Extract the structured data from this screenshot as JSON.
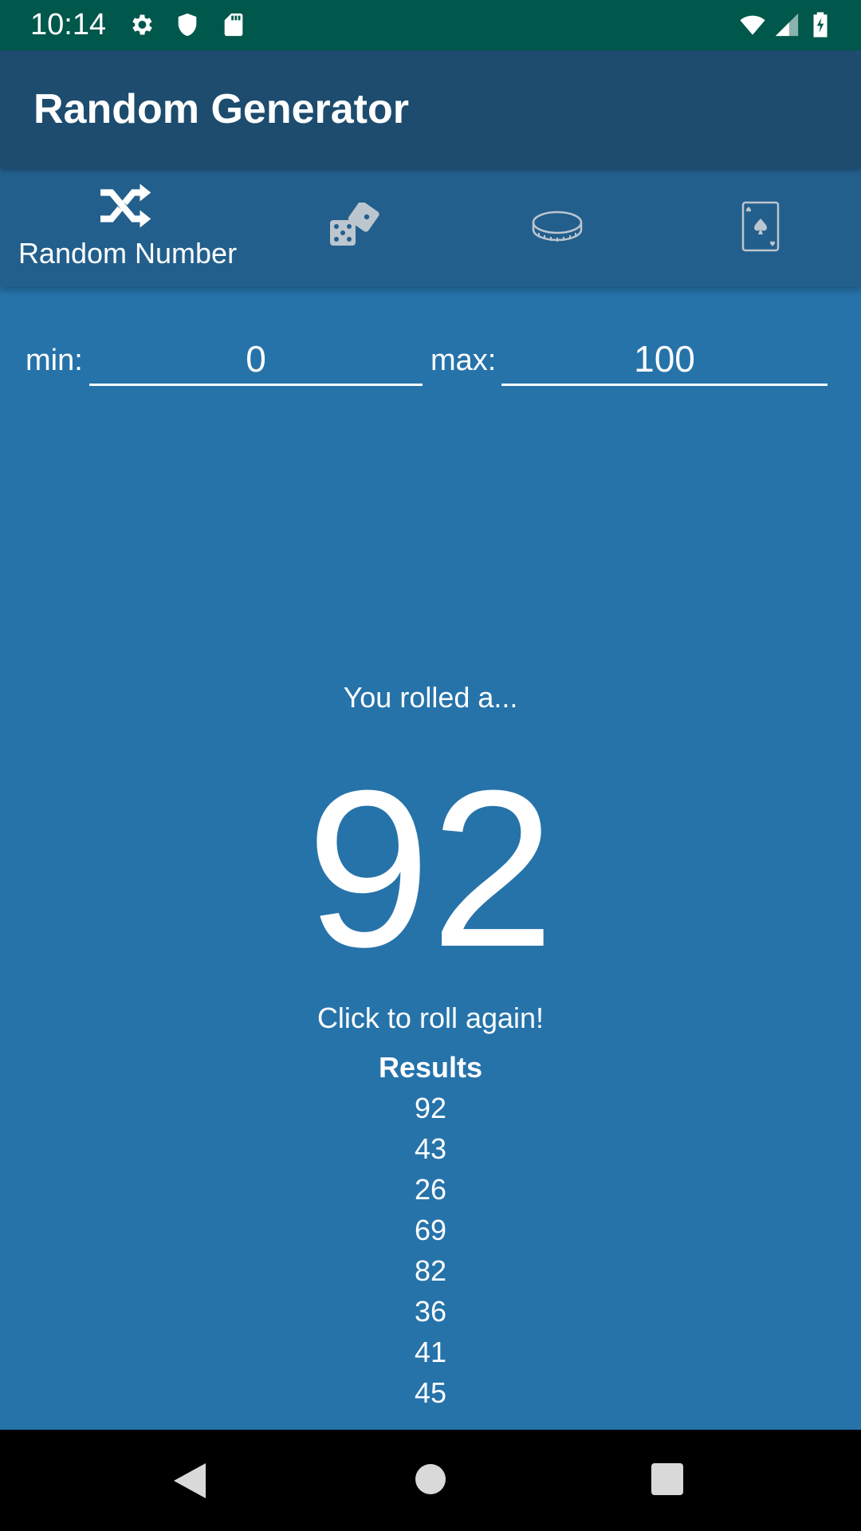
{
  "status_bar": {
    "time": "10:14",
    "icons": [
      "gear-icon",
      "shield-icon",
      "sd-card-icon",
      "wifi-icon",
      "signal-icon",
      "battery-charging-icon"
    ]
  },
  "app_bar": {
    "title": "Random Generator"
  },
  "tabs": [
    {
      "icon": "shuffle-icon",
      "label": "Random Number",
      "selected": true
    },
    {
      "icon": "dice-icon",
      "label": "",
      "selected": false
    },
    {
      "icon": "coin-icon",
      "label": "",
      "selected": false
    },
    {
      "icon": "playing-card-icon",
      "label": "",
      "selected": false
    }
  ],
  "range": {
    "min_label": "min:",
    "min_value": "0",
    "max_label": "max:",
    "max_value": "100"
  },
  "result": {
    "caption": "You rolled a...",
    "value": "92",
    "prompt": "Click to roll again!",
    "history_heading": "Results",
    "history": [
      "92",
      "43",
      "26",
      "69",
      "82",
      "36",
      "41",
      "45"
    ]
  },
  "colors": {
    "status_bar": "#00574b",
    "app_bar": "#1d4c6e",
    "tab_bar": "#235f8c",
    "background": "#2673aa",
    "text": "#ffffff",
    "nav_bar": "#000000"
  }
}
